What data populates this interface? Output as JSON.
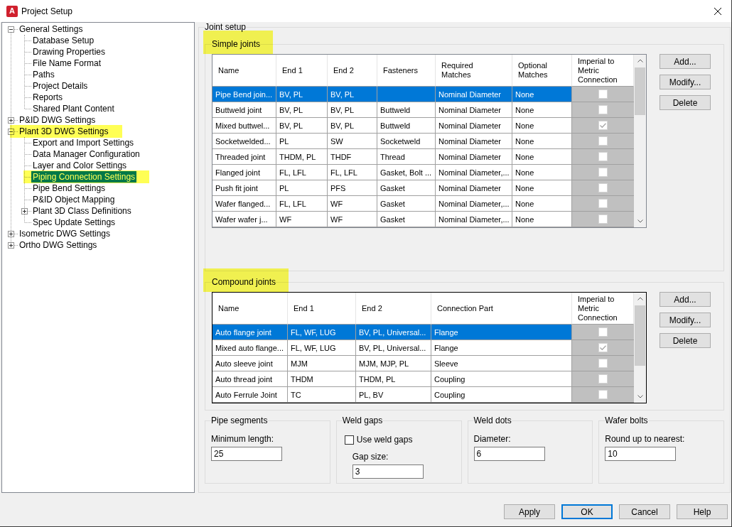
{
  "window": {
    "title": "Project Setup",
    "icon_letter": "A"
  },
  "tree": [
    {
      "label": "General Settings",
      "expanded": true,
      "selected": false,
      "highlighted": false,
      "children": [
        {
          "label": "Database Setup",
          "selected": false,
          "highlighted": false
        },
        {
          "label": "Drawing Properties",
          "selected": false,
          "highlighted": false
        },
        {
          "label": "File Name Format",
          "selected": false,
          "highlighted": false
        },
        {
          "label": "Paths",
          "selected": false,
          "highlighted": false
        },
        {
          "label": "Project Details",
          "selected": false,
          "highlighted": false
        },
        {
          "label": "Reports",
          "selected": false,
          "highlighted": false
        },
        {
          "label": "Shared Plant Content",
          "selected": false,
          "highlighted": false
        }
      ]
    },
    {
      "label": "P&ID DWG Settings",
      "expanded": false,
      "selected": false,
      "highlighted": false
    },
    {
      "label": "Plant 3D DWG Settings",
      "expanded": true,
      "selected": false,
      "highlighted": true,
      "children": [
        {
          "label": "Export and Import Settings",
          "selected": false,
          "highlighted": false
        },
        {
          "label": "Data Manager Configuration",
          "selected": false,
          "highlighted": false
        },
        {
          "label": "Layer and Color Settings",
          "selected": false,
          "highlighted": false
        },
        {
          "label": "Piping Connection Settings",
          "selected": true,
          "highlighted": true
        },
        {
          "label": "Pipe Bend Settings",
          "selected": false,
          "highlighted": false
        },
        {
          "label": "P&ID Object Mapping",
          "selected": false,
          "highlighted": false
        },
        {
          "label": "Plant 3D Class Definitions",
          "expanded": false,
          "selected": false,
          "highlighted": false
        },
        {
          "label": "Spec Update Settings",
          "selected": false,
          "highlighted": false
        }
      ]
    },
    {
      "label": "Isometric DWG Settings",
      "expanded": false,
      "selected": false,
      "highlighted": false
    },
    {
      "label": "Ortho DWG Settings",
      "expanded": false,
      "selected": false,
      "highlighted": false
    }
  ],
  "joint_setup": {
    "title": "Joint setup",
    "simple_joints": {
      "title": "Simple joints",
      "highlighted": true,
      "focused": false,
      "columns": [
        "Name",
        "End 1",
        "End 2",
        "Fasteners",
        "Required\nMatches",
        "Optional\nMatches",
        "Imperial to\nMetric\nConnection"
      ],
      "rows": [
        {
          "name": "Pipe Bend join...",
          "end_1": "BV, PL",
          "end_2": "BV, PL",
          "required_matches": "Nominal Diameter",
          "optional_matches": "None",
          "imperial_to_metric": false,
          "selected": true
        },
        {
          "name": "Buttweld joint",
          "end_1": "BV, PL",
          "end_2": "BV, PL",
          "fasteners": "Buttweld",
          "required_matches": "Nominal Diameter",
          "optional_matches": "None",
          "imperial_to_metric": false,
          "selected": false
        },
        {
          "name": "Mixed buttwel...",
          "end_1": "BV, PL",
          "end_2": "BV, PL",
          "fasteners": "Buttweld",
          "required_matches": "Nominal Diameter",
          "optional_matches": "None",
          "imperial_to_metric": true,
          "selected": false
        },
        {
          "name": "Socketwelded...",
          "end_1": "PL",
          "end_2": "SW",
          "fasteners": "Socketweld",
          "required_matches": "Nominal Diameter",
          "optional_matches": "None",
          "imperial_to_metric": false,
          "selected": false
        },
        {
          "name": "Threaded joint",
          "end_1": "THDM, PL",
          "end_2": "THDF",
          "fasteners": "Thread",
          "required_matches": "Nominal Diameter",
          "optional_matches": "None",
          "imperial_to_metric": false,
          "selected": false
        },
        {
          "name": "Flanged joint",
          "end_1": "FL, LFL",
          "end_2": "FL, LFL",
          "fasteners": "Gasket, Bolt ...",
          "required_matches": "Nominal Diameter,...",
          "optional_matches": "None",
          "imperial_to_metric": false,
          "selected": false
        },
        {
          "name": "Push fit joint",
          "end_1": "PL",
          "end_2": "PFS",
          "fasteners": "Gasket",
          "required_matches": "Nominal Diameter",
          "optional_matches": "None",
          "imperial_to_metric": false,
          "selected": false
        },
        {
          "name": "Wafer flanged...",
          "end_1": "FL, LFL",
          "end_2": "WF",
          "fasteners": "Gasket",
          "required_matches": "Nominal Diameter,...",
          "optional_matches": "None",
          "imperial_to_metric": false,
          "selected": false
        },
        {
          "name": "Wafer wafer j...",
          "end_1": "WF",
          "end_2": "WF",
          "fasteners": "Gasket",
          "required_matches": "Nominal Diameter,...",
          "optional_matches": "None",
          "imperial_to_metric": false,
          "selected": false
        }
      ],
      "buttons": [
        "Add...",
        "Modify...",
        "Delete"
      ]
    },
    "compound_joints": {
      "title": "Compound joints",
      "highlighted": true,
      "focused": true,
      "columns": [
        "Name",
        "End 1",
        "End 2",
        "Connection Part",
        "Imperial to\nMetric\nConnection"
      ],
      "rows": [
        {
          "name": "Auto flange joint",
          "end_1": "FL, WF, LUG",
          "end_2": "BV, PL, Universal...",
          "connection_part": "Flange",
          "imperial_to_metric": false,
          "selected": true
        },
        {
          "name": "Mixed auto flange...",
          "end_1": "FL, WF, LUG",
          "end_2": "BV, PL, Universal...",
          "connection_part": "Flange",
          "imperial_to_metric": true,
          "selected": false
        },
        {
          "name": "Auto sleeve joint",
          "end_1": "MJM",
          "end_2": "MJM, MJP, PL",
          "connection_part": "Sleeve",
          "imperial_to_metric": false,
          "selected": false
        },
        {
          "name": "Auto thread joint",
          "end_1": "THDM",
          "end_2": "THDM, PL",
          "connection_part": "Coupling",
          "imperial_to_metric": false,
          "selected": false
        },
        {
          "name": "Auto Ferrule Joint",
          "end_1": "TC",
          "end_2": "PL, BV",
          "connection_part": "Coupling",
          "imperial_to_metric": false,
          "selected": false
        }
      ],
      "buttons": [
        "Add...",
        "Modify...",
        "Delete"
      ]
    },
    "settings_groups": [
      {
        "title": "Pipe segments",
        "items": [
          {
            "kind": "field",
            "label": "Minimum length:",
            "value": "25"
          }
        ]
      },
      {
        "title": "Weld gaps",
        "items": [
          {
            "kind": "checkbox",
            "label": "Use weld gaps",
            "checked": false,
            "children": [
              {
                "kind": "field",
                "label": "Gap size:",
                "value": "3"
              }
            ]
          }
        ]
      },
      {
        "title": "Weld dots",
        "items": [
          {
            "kind": "field",
            "label": "Diameter:",
            "value": "6"
          }
        ]
      },
      {
        "title": "Wafer bolts",
        "items": [
          {
            "kind": "field",
            "label": "Round up to nearest:",
            "value": "10"
          }
        ]
      }
    ]
  },
  "buttons": [
    {
      "label": "Apply",
      "default": false
    },
    {
      "label": "OK",
      "default": true
    },
    {
      "label": "Cancel",
      "default": false
    },
    {
      "label": "Help",
      "default": false
    }
  ]
}
